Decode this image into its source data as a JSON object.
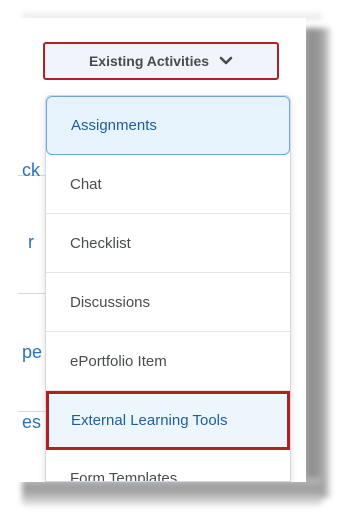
{
  "toolbar": {
    "existing_activities_label": "Existing Activities",
    "chevron_icon": "chevron-down-icon"
  },
  "background_list": {
    "fragments": [
      "ck",
      "r",
      "pe",
      "es"
    ]
  },
  "menu": {
    "items": [
      {
        "label": "Assignments",
        "state": "focused"
      },
      {
        "label": "Chat"
      },
      {
        "label": "Checklist"
      },
      {
        "label": "Discussions"
      },
      {
        "label": "ePortfolio Item"
      },
      {
        "label": "External Learning Tools",
        "state": "highlighted"
      },
      {
        "label": "Form Templates"
      }
    ]
  },
  "colors": {
    "highlight_border": "#b02025",
    "focus_background": "#e6f3fc",
    "link_blue": "#2a73b8",
    "text": "#494c4e"
  }
}
